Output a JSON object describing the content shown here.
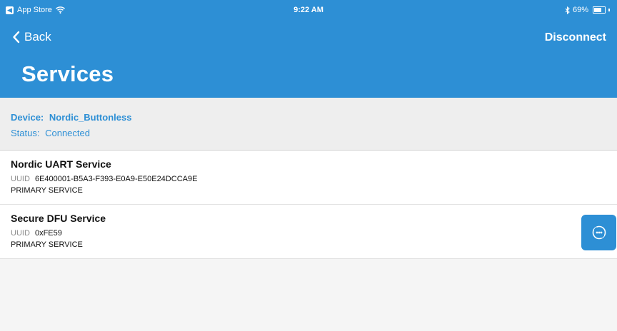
{
  "status_bar": {
    "carrier": "App Store",
    "time": "9:22 AM",
    "battery_percent": "69%",
    "battery_level": 0.69,
    "icons": [
      "back-to-app-icon",
      "wifi-icon",
      "bluetooth-icon",
      "battery-icon"
    ]
  },
  "nav": {
    "back_label": "Back",
    "right_action": "Disconnect",
    "title": "Services"
  },
  "device_info": {
    "device_label": "Device:",
    "device_name": "Nordic_Buttonless",
    "status_label": "Status:",
    "status_value": "Connected"
  },
  "services": [
    {
      "name": "Nordic UART Service",
      "uuid_label": "UUID",
      "uuid": "6E400001-B5A3-F393-E0A9-E50E24DCCA9E",
      "type": "PRIMARY SERVICE"
    },
    {
      "name": "Secure DFU Service",
      "uuid_label": "UUID",
      "uuid": "0xFE59",
      "type": "PRIMARY SERVICE",
      "action_icon": "dfu-icon"
    }
  ],
  "colors": {
    "accent": "#2d8fd5",
    "background": "#f5f5f5",
    "info_panel": "#eeeeee"
  }
}
